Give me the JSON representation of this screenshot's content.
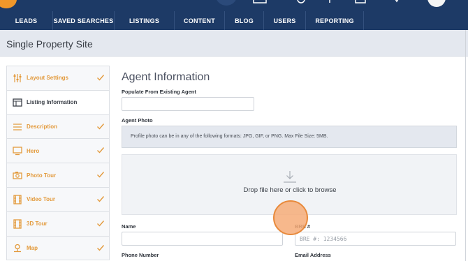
{
  "nav": {
    "items": [
      {
        "label": "LEADS",
        "w": 76
      },
      {
        "label": "SAVED SEARCHES",
        "w": 88
      },
      {
        "label": "LISTINGS",
        "w": 86
      },
      {
        "label": "CONTENT",
        "w": 72
      },
      {
        "label": "BLOG",
        "w": 56
      },
      {
        "label": "USERS",
        "w": 60
      },
      {
        "label": "REPORTING",
        "w": 83
      }
    ]
  },
  "page": {
    "title": "Single Property Site"
  },
  "sidebar": {
    "items": [
      {
        "label": "Layout Settings",
        "icon": "sliders-icon",
        "checked": true,
        "active": false
      },
      {
        "label": "Listing Information",
        "icon": "table-icon",
        "checked": false,
        "active": true
      },
      {
        "label": "Description",
        "icon": "lines-icon",
        "checked": true,
        "active": false
      },
      {
        "label": "Hero",
        "icon": "monitor-icon",
        "checked": true,
        "active": false
      },
      {
        "label": "Photo Tour",
        "icon": "camera-icon",
        "checked": true,
        "active": false
      },
      {
        "label": "Video Tour",
        "icon": "film-icon",
        "checked": true,
        "active": false
      },
      {
        "label": "3D Tour",
        "icon": "film-icon",
        "checked": true,
        "active": false
      },
      {
        "label": "Map",
        "icon": "map-pin-icon",
        "checked": true,
        "active": false
      }
    ]
  },
  "main": {
    "title": "Agent Information",
    "populate_label": "Populate From Existing Agent",
    "populate_value": "",
    "photo_label": "Agent Photo",
    "photo_notice": "Profile photo can be in any of the following formats: JPG, GIF, or PNG. Max File Size: 5MB.",
    "dropzone_text": "Drop file here or click to browse",
    "name_label": "Name",
    "name_value": "",
    "bre_label": "BRE #",
    "bre_placeholder": "BRE #: 1234566",
    "phone_label": "Phone Number",
    "email_label": "Email Address"
  },
  "colors": {
    "nav_bg": "#1d3a66",
    "accent": "#e39a3c",
    "band_bg": "#e4e8ef"
  }
}
